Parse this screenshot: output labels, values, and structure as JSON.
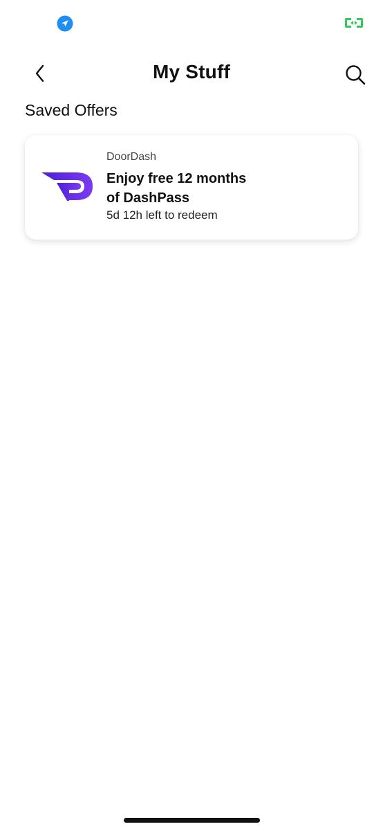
{
  "status_bar": {
    "location_icon": "location-arrow-icon",
    "location_color": "#1E8EF0",
    "screen_icon": "screen-mirroring-icon",
    "screen_color": "#34C759"
  },
  "header": {
    "title": "My Stuff",
    "back_icon": "chevron-left-icon",
    "search_icon": "search-icon"
  },
  "section": {
    "title": "Saved Offers"
  },
  "offers": [
    {
      "brand": "DoorDash",
      "title_line1": "Enjoy free 12 months",
      "title_line2": "of DashPass",
      "expiry": "5d 12h left to redeem",
      "logo_icon": "dashpass-logo-icon",
      "logo_color": "#6B2FE3"
    }
  ]
}
